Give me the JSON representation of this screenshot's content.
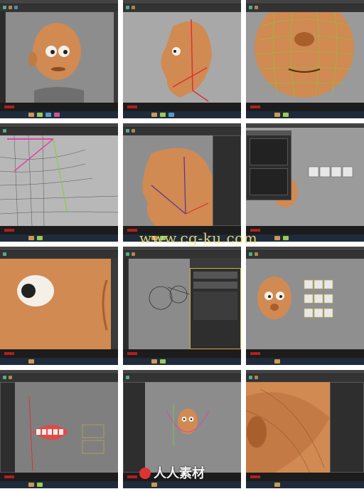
{
  "watermark_url": "www.cg-ku.com",
  "watermark_brand": "人人素材",
  "tiles": [
    {
      "label": "head-front-view",
      "viewport": "#8d8d8d"
    },
    {
      "label": "head-side-profile",
      "viewport": "#a8a8a8"
    },
    {
      "label": "face-wireframe-closeup",
      "viewport": "#9a9a9a"
    },
    {
      "label": "neck-wireframe-joints",
      "viewport": "#b8b8b8"
    },
    {
      "label": "head-side-joint-chain",
      "viewport": "#8e8e8e"
    },
    {
      "label": "graph-editor-face-controls",
      "viewport": "#9b9b9b"
    },
    {
      "label": "eye-closeup",
      "viewport": "#9c9c9c"
    },
    {
      "label": "attribute-editor-circles",
      "viewport": "#8b8b8b"
    },
    {
      "label": "head-with-control-panel",
      "viewport": "#8f8f8f"
    },
    {
      "label": "teeth-rig-controls",
      "viewport": "#7f7f7f"
    },
    {
      "label": "small-head-curves",
      "viewport": "#8c8c8c"
    },
    {
      "label": "mouth-corner-closeup",
      "viewport": "#8c8c8c"
    }
  ],
  "colors": {
    "skin": "#d08a52",
    "skin_shadow": "#a85f2c",
    "wire_green": "#7ad13a",
    "wire_pink": "#d84aa8",
    "rig_red": "#e03030",
    "ui_dark": "#3a3a3a"
  }
}
